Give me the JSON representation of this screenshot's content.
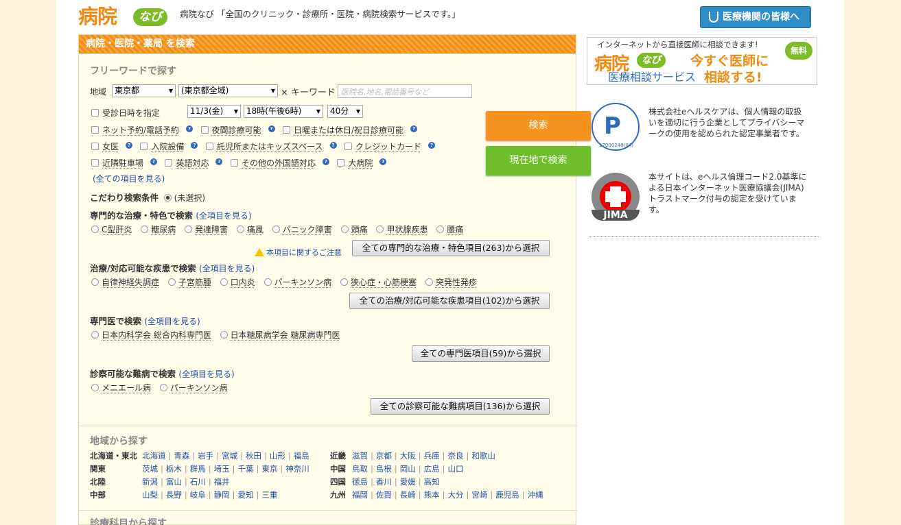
{
  "header": {
    "logo_kanji": "病院",
    "logo_navi": "なび",
    "tagline": "病院なび 「全国のクリニック・診療所・医院・病院検索サービスです。」",
    "pro_button": "医療機関の皆様へ"
  },
  "search": {
    "title": "病院・医院・薬局 を検索",
    "freeword_title": "フリーワードで探す",
    "region_label": "地域",
    "prefecture": "東京都",
    "area": "(東京都全域)",
    "keyword_label": "× キーワード",
    "keyword_placeholder": "医院名,地名,電話番号など",
    "date_label": "受診日時を指定",
    "date": "11/3(金)",
    "time": "18時(午後6時)",
    "minutes": "40分",
    "checkboxes_row1": [
      "ネット予約/電話予約",
      "夜間診療可能",
      "日曜または休日/祝日診療可能"
    ],
    "checkboxes_row2": [
      "女医",
      "入院設備",
      "託児所またはキッズスペース",
      "クレジットカード"
    ],
    "checkboxes_row3": [
      "近隣駐車場",
      "英語対応",
      "その他の外国語対応",
      "大病院"
    ],
    "see_all_items": "(全ての項目を見る)",
    "search_button": "検索",
    "location_button": "現在地で検索",
    "kodawari_label": "こだわり検索条件",
    "kodawari_value": "(未選択)",
    "special": {
      "title": "専門的な治療・特色で検索",
      "see_all": "(全項目を見る)",
      "options": [
        "C型肝炎",
        "糖尿病",
        "発達障害",
        "痛風",
        "パニック障害",
        "頭痛",
        "甲状腺疾患",
        "腰痛"
      ],
      "warning": "本項目に関するご注意",
      "button": "全ての専門的な治療・特色項目(263)から選択"
    },
    "disease": {
      "title": "治療/対応可能な疾患で検索",
      "see_all": "(全項目を見る)",
      "options": [
        "自律神経失調症",
        "子宮筋腫",
        "口内炎",
        "パーキンソン病",
        "狭心症・心筋梗塞",
        "突発性発疹"
      ],
      "button": "全ての治療/対応可能な疾患項目(102)から選択"
    },
    "specialist": {
      "title": "専門医で検索",
      "see_all": "(全項目を見る)",
      "options": [
        "日本内科学会 総合内科専門医",
        "日本糖尿病学会 糖尿病専門医"
      ],
      "button": "全ての専門医項目(59)から選択"
    },
    "rare": {
      "title": "診察可能な難病で検索",
      "see_all": "(全項目を見る)",
      "options": [
        "メニエール病",
        "パーキンソン病"
      ],
      "button": "全ての診察可能な難病項目(136)から選択"
    }
  },
  "region_search": {
    "title": "地域から探す",
    "left": [
      {
        "region": "北海道・東北",
        "prefs": [
          "北海道",
          "青森",
          "岩手",
          "宮城",
          "秋田",
          "山形",
          "福島"
        ]
      },
      {
        "region": "関東",
        "prefs": [
          "茨城",
          "栃木",
          "群馬",
          "埼玉",
          "千葉",
          "東京",
          "神奈川"
        ]
      },
      {
        "region": "北陸",
        "prefs": [
          "新潟",
          "富山",
          "石川",
          "福井"
        ]
      },
      {
        "region": "中部",
        "prefs": [
          "山梨",
          "長野",
          "岐阜",
          "静岡",
          "愛知",
          "三重"
        ]
      }
    ],
    "right": [
      {
        "region": "近畿",
        "prefs": [
          "滋賀",
          "京都",
          "大阪",
          "兵庫",
          "奈良",
          "和歌山"
        ]
      },
      {
        "region": "中国",
        "prefs": [
          "鳥取",
          "島根",
          "岡山",
          "広島",
          "山口"
        ]
      },
      {
        "region": "四国",
        "prefs": [
          "徳島",
          "香川",
          "愛媛",
          "高知"
        ]
      },
      {
        "region": "九州",
        "prefs": [
          "福岡",
          "佐賀",
          "長崎",
          "熊本",
          "大分",
          "宮崎",
          "鹿児島",
          "沖縄"
        ]
      }
    ]
  },
  "dept_search": {
    "title": "診療科目から探す"
  },
  "sidebar": {
    "ad_top": "インターネットから直接医師に相談できます!",
    "ad_kanji": "病院",
    "ad_navi": "なび",
    "ad_service": "医療相談サービス",
    "ad_headline1": "今すぐ医師に",
    "ad_headline2": "相談する!",
    "ad_free": "無料",
    "pmark_number": "17000248(04)",
    "pmark_text": "株式会社eヘルスケアは、個人情報の取扱いを適切に行う企業としてプライバシーマークの使用を認められた認定事業者です。",
    "jima_label": "JIMA",
    "jima_text": "本サイトは、eヘルス倫理コード2.0基準による日本インターネット医療協議会(JIMA)トラストマーク付与の認定を受けています。"
  },
  "colors": {
    "accent": "#f6921e",
    "green": "#6fbe2c",
    "link": "#1f4fa8",
    "pro": "#2e8cc6"
  }
}
